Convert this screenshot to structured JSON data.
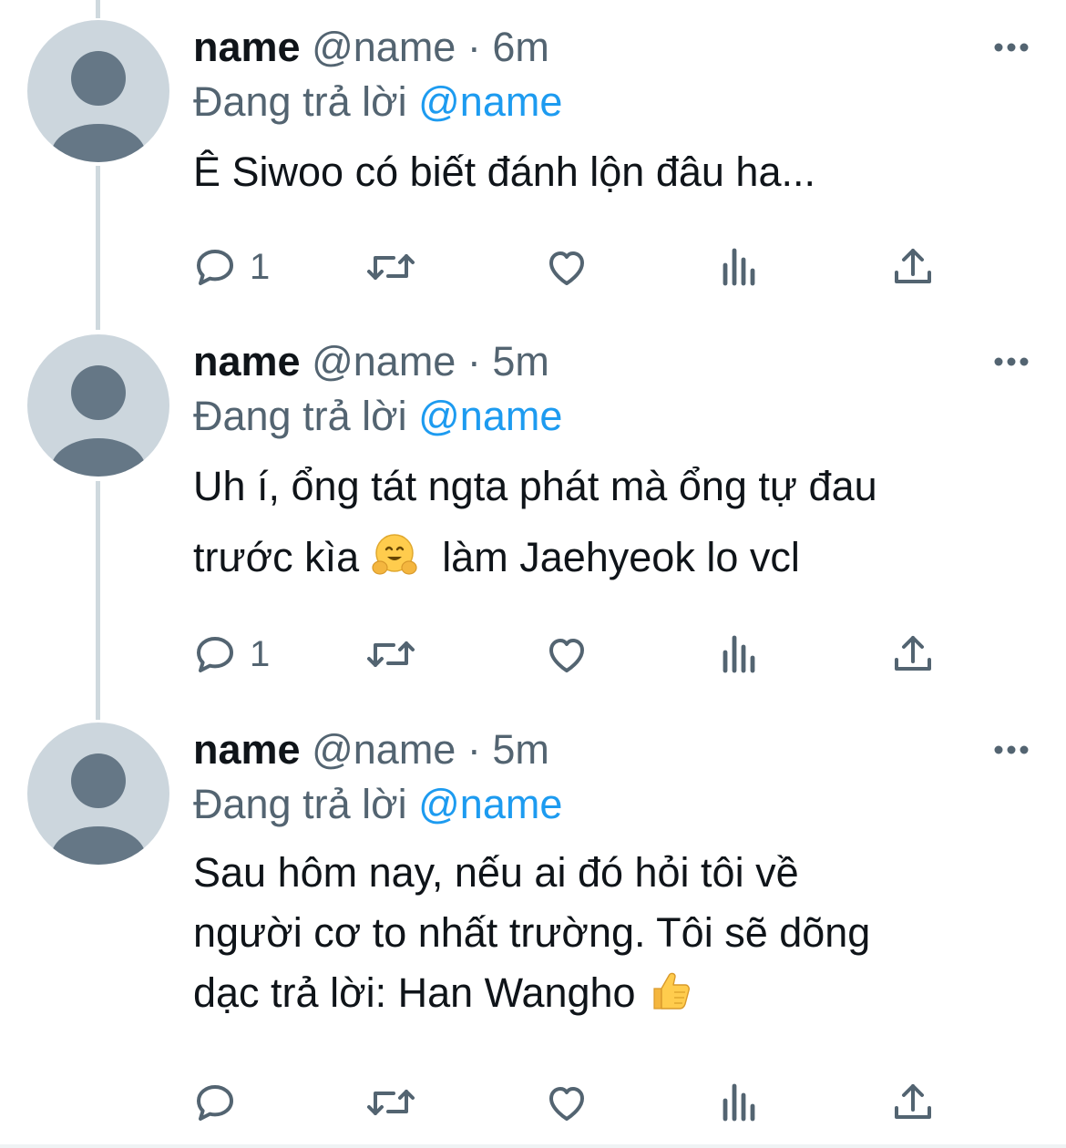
{
  "tweets": [
    {
      "name": "name",
      "handle": "@name",
      "sep": " · ",
      "time": "6m",
      "replying_prefix": "Đang trả lời ",
      "replying_to": "@name",
      "lines": [
        "Ê Siwoo có biết đánh lộn đâu ha..."
      ],
      "reply_count": "1"
    },
    {
      "name": "name",
      "handle": "@name",
      "sep": " · ",
      "time": "5m",
      "replying_prefix": "Đang trả lời ",
      "replying_to": "@name",
      "lines": [
        "Uh í, ổng tát ngta phát mà ổng tự đau",
        "trước kìa",
        "làm Jaehyeok lo vcl"
      ],
      "emoji": "hugging-face",
      "reply_count": "1"
    },
    {
      "name": "name",
      "handle": "@name",
      "sep": " · ",
      "time": "5m",
      "replying_prefix": "Đang trả lời ",
      "replying_to": "@name",
      "lines": [
        "Sau hôm nay, nếu ai đó hỏi tôi về",
        "người cơ to nhất trường. Tôi sẽ dõng",
        "dạc trả lời: Han Wangho"
      ],
      "emoji": "thumbs-up",
      "reply_count": ""
    }
  ],
  "colors": {
    "text": "#0f1419",
    "secondary": "#536471",
    "link": "#1d9bf0",
    "thread_line": "#cfd9de",
    "avatar_bg": "#ccd6dd",
    "avatar_fg": "#657786"
  },
  "icons": [
    "more-icon",
    "reply-icon",
    "retweet-icon",
    "like-icon",
    "analytics-icon",
    "share-icon"
  ]
}
